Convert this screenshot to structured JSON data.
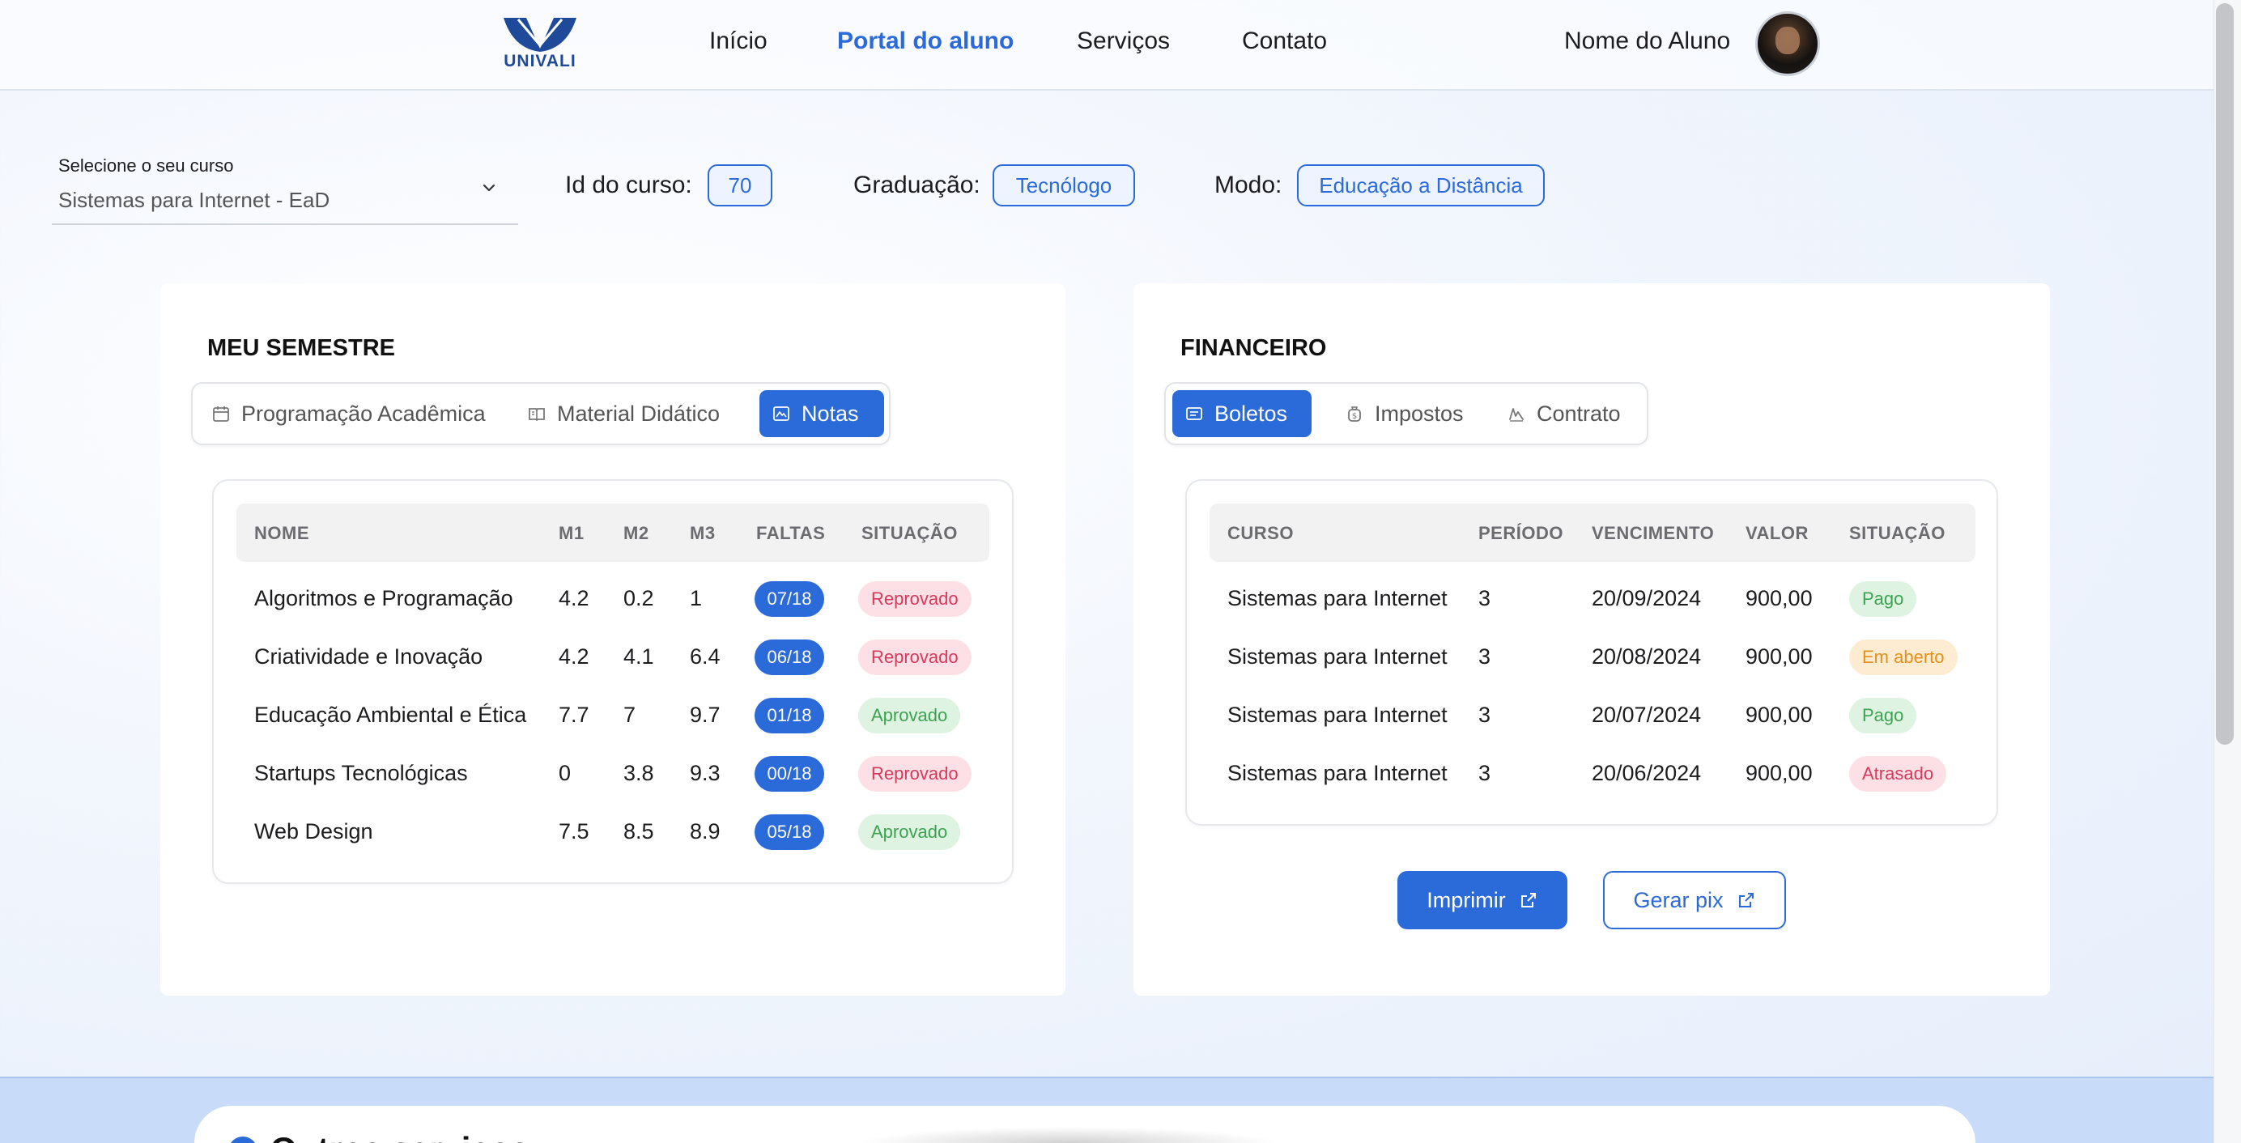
{
  "header": {
    "logo_text": "UNIVALI",
    "nav": [
      "Início",
      "Portal do aluno",
      "Serviços",
      "Contato"
    ],
    "active_nav": "Portal do aluno",
    "user_name": "Nome do Aluno"
  },
  "course": {
    "select_label": "Selecione o seu curso",
    "select_value": "Sistemas para Internet - EaD",
    "id_label": "Id do curso:",
    "id_value": "70",
    "grad_label": "Graduação:",
    "grad_value": "Tecnólogo",
    "mode_label": "Modo:",
    "mode_value": "Educação a Distância"
  },
  "semestre": {
    "title": "MEU SEMESTRE",
    "tabs": [
      "Programação Acadêmica",
      "Material Didático",
      "Notas"
    ],
    "active_tab": "Notas",
    "headers": [
      "NOME",
      "M1",
      "M2",
      "M3",
      "FALTAS",
      "SITUAÇÃO"
    ],
    "rows": [
      {
        "nome": "Algoritmos e Programação",
        "m1": "4.2",
        "m2": "0.2",
        "m3": "1",
        "faltas": "07/18",
        "situacao": "Reprovado",
        "status": "red"
      },
      {
        "nome": "Criatividade e Inovação",
        "m1": "4.2",
        "m2": "4.1",
        "m3": "6.4",
        "faltas": "06/18",
        "situacao": "Reprovado",
        "status": "red"
      },
      {
        "nome": "Educação Ambiental e Ética",
        "m1": "7.7",
        "m2": "7",
        "m3": "9.7",
        "faltas": "01/18",
        "situacao": "Aprovado",
        "status": "green"
      },
      {
        "nome": "Startups Tecnológicas",
        "m1": "0",
        "m2": "3.8",
        "m3": "9.3",
        "faltas": "00/18",
        "situacao": "Reprovado",
        "status": "red"
      },
      {
        "nome": "Web Design",
        "m1": "7.5",
        "m2": "8.5",
        "m3": "8.9",
        "faltas": "05/18",
        "situacao": "Aprovado",
        "status": "green"
      }
    ]
  },
  "financeiro": {
    "title": "FINANCEIRO",
    "tabs": [
      "Boletos",
      "Impostos",
      "Contrato"
    ],
    "active_tab": "Boletos",
    "headers": [
      "CURSO",
      "PERÍODO",
      "VENCIMENTO",
      "VALOR",
      "SITUAÇÃO"
    ],
    "rows": [
      {
        "curso": "Sistemas para Internet",
        "periodo": "3",
        "vencimento": "20/09/2024",
        "valor": "900,00",
        "situacao": "Pago",
        "status": "green"
      },
      {
        "curso": "Sistemas para Internet",
        "periodo": "3",
        "vencimento": "20/08/2024",
        "valor": "900,00",
        "situacao": "Em aberto",
        "status": "orange"
      },
      {
        "curso": "Sistemas para Internet",
        "periodo": "3",
        "vencimento": "20/07/2024",
        "valor": "900,00",
        "situacao": "Pago",
        "status": "green"
      },
      {
        "curso": "Sistemas para Internet",
        "periodo": "3",
        "vencimento": "20/06/2024",
        "valor": "900,00",
        "situacao": "Atrasado",
        "status": "red"
      }
    ],
    "btn_print": "Imprimir",
    "btn_pix": "Gerar pix"
  },
  "bottom": {
    "title": "Outros serviços"
  },
  "colors": {
    "accent": "#2b6ad9",
    "badge_red_bg": "#fde0e6",
    "badge_green_bg": "#def3e1",
    "badge_orange_bg": "#fdecd2"
  }
}
